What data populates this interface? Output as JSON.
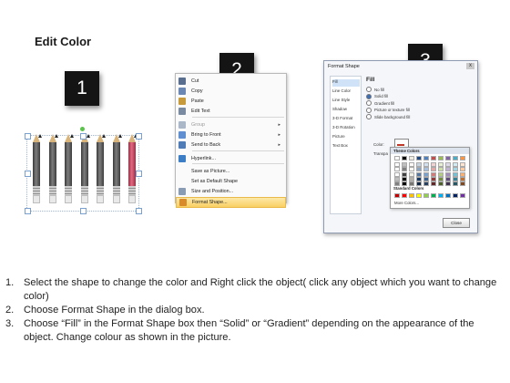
{
  "page": {
    "title": "Edit Color"
  },
  "steps": [
    "1",
    "2",
    "3"
  ],
  "pencils": {
    "count": 7,
    "highlight_color": "#c9405c",
    "body_color": "#555555"
  },
  "context_menu": {
    "items": [
      {
        "label": "Cut",
        "icon": "scissors-icon",
        "enabled": true,
        "submenu": false
      },
      {
        "label": "Copy",
        "icon": "copy-icon",
        "enabled": true,
        "submenu": false
      },
      {
        "label": "Paste",
        "icon": "paste-icon",
        "enabled": true,
        "submenu": false
      },
      {
        "label": "Edit Text",
        "icon": "edit-text-icon",
        "enabled": true,
        "submenu": false
      },
      {
        "label": "Group",
        "icon": "group-icon",
        "enabled": false,
        "submenu": true
      },
      {
        "label": "Bring to Front",
        "icon": "bring-front-icon",
        "enabled": true,
        "submenu": true
      },
      {
        "label": "Send to Back",
        "icon": "send-back-icon",
        "enabled": true,
        "submenu": true
      },
      {
        "label": "Hyperlink...",
        "icon": "hyperlink-icon",
        "enabled": true,
        "submenu": false
      },
      {
        "label": "Save as Picture...",
        "icon": "",
        "enabled": true,
        "submenu": false
      },
      {
        "label": "Set as Default Shape",
        "icon": "",
        "enabled": true,
        "submenu": false
      },
      {
        "label": "Size and Position...",
        "icon": "size-position-icon",
        "enabled": true,
        "submenu": false
      },
      {
        "label": "Format Shape...",
        "icon": "format-shape-icon",
        "enabled": true,
        "submenu": false,
        "highlighted": true
      }
    ]
  },
  "dialog": {
    "title": "Format Shape",
    "close_glyph": "x",
    "nav": [
      "Fill",
      "Line Color",
      "Line Style",
      "Shadow",
      "3-D Format",
      "3-D Rotation",
      "Picture",
      "Text Box"
    ],
    "active_nav": "Fill",
    "section_title": "Fill",
    "options": [
      "No fill",
      "Solid fill",
      "Gradient fill",
      "Picture or texture fill",
      "Slide background fill"
    ],
    "selected_option": "Solid fill",
    "color_label": "Color:",
    "transparency_label": "Transpa",
    "palette": {
      "theme_title": "Theme Colors",
      "standard_title": "Standard Colors",
      "more_label": "More Colors...",
      "theme_top": [
        "#ffffff",
        "#000000",
        "#eeece1",
        "#1f497d",
        "#4f81bd",
        "#c0504d",
        "#9bbb59",
        "#8064a2",
        "#4bacc6",
        "#f79646"
      ],
      "standard": [
        "#c00000",
        "#ff0000",
        "#ffc000",
        "#ffff00",
        "#92d050",
        "#00b050",
        "#00b0f0",
        "#0070c0",
        "#002060",
        "#7030a0"
      ]
    },
    "close_button": "Close"
  },
  "instructions": [
    {
      "num": "1.",
      "text": "Select the shape to change the color and Right click the object( click any object which you want to change color)"
    },
    {
      "num": "2.",
      "text": "Choose Format Shape in the dialog box."
    },
    {
      "num": "3.",
      "text": "Choose “Fill” in the Format Shape box then “Solid” or “Gradient” depending on the appearance of the object. Change colour as shown in the picture."
    }
  ]
}
